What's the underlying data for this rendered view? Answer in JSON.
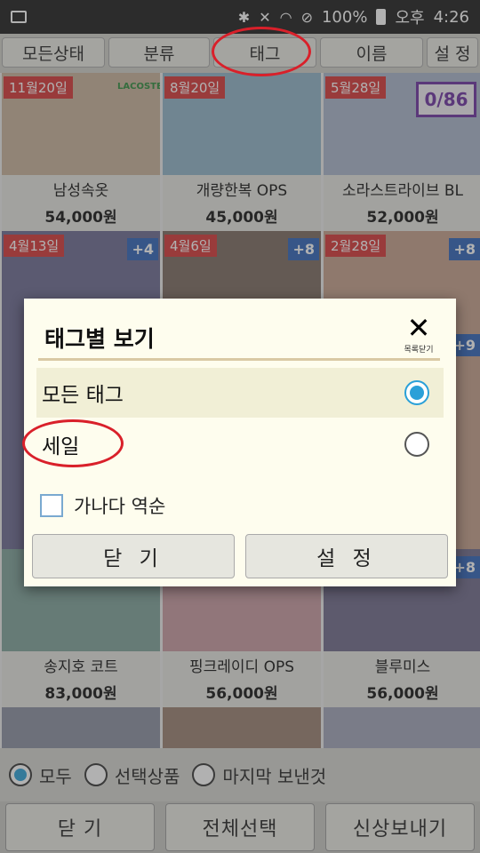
{
  "status_bar": {
    "battery": "100%",
    "ampm": "오후",
    "time": "4:26"
  },
  "tabs": [
    "모든상태",
    "분류",
    "태그",
    "이름",
    "설 정"
  ],
  "products": [
    {
      "date": "11월20일",
      "name": "남성속옷",
      "price": "54,000원",
      "brand": "LACOSTE",
      "img_color": "#c8b29a"
    },
    {
      "date": "8월20일",
      "name": "개량한복 OPS",
      "price": "45,000원",
      "img_color": "#8fb3c9"
    },
    {
      "date": "5월28일",
      "name": "소라스트라이브 BL",
      "price": "52,000원",
      "img_color": "#a9b6cc",
      "count": "0/86"
    },
    {
      "date": "4월13일",
      "plus": "+4",
      "img_color": "#6b6a92"
    },
    {
      "date": "4월6일",
      "plus": "+8",
      "img_color": "#7a6a60"
    },
    {
      "date": "2월28일",
      "plus": "+8",
      "img_color": "#c59f8a"
    },
    {
      "name": "송지호 코트",
      "price": "83,000원",
      "img_color": "#7fa39a",
      "plus": ""
    },
    {
      "name": "핑크레이디 OPS",
      "price": "56,000원",
      "img_color": "#c89aa0"
    },
    {
      "name": "블루미스",
      "price": "56,000원",
      "img_color": "#6e6a8a",
      "plus": "+8"
    }
  ],
  "side_plus": "+9",
  "dialog": {
    "title": "태그별 보기",
    "close_label": "목록닫기",
    "options": [
      "모든 태그",
      "세일"
    ],
    "checkbox_label": "가나다 역순",
    "close_button": "닫 기",
    "set_button": "설 정"
  },
  "bottom_radio": [
    "모두",
    "선택상품",
    "마지막 보낸것"
  ],
  "bottom_buttons": [
    "닫 기",
    "전체선택",
    "신상보내기"
  ],
  "colors": {
    "accent_blue": "#2aa0d8",
    "badge_red": "#d63535",
    "badge_blue": "#2d63b8",
    "highlight_red": "#d9202a"
  }
}
